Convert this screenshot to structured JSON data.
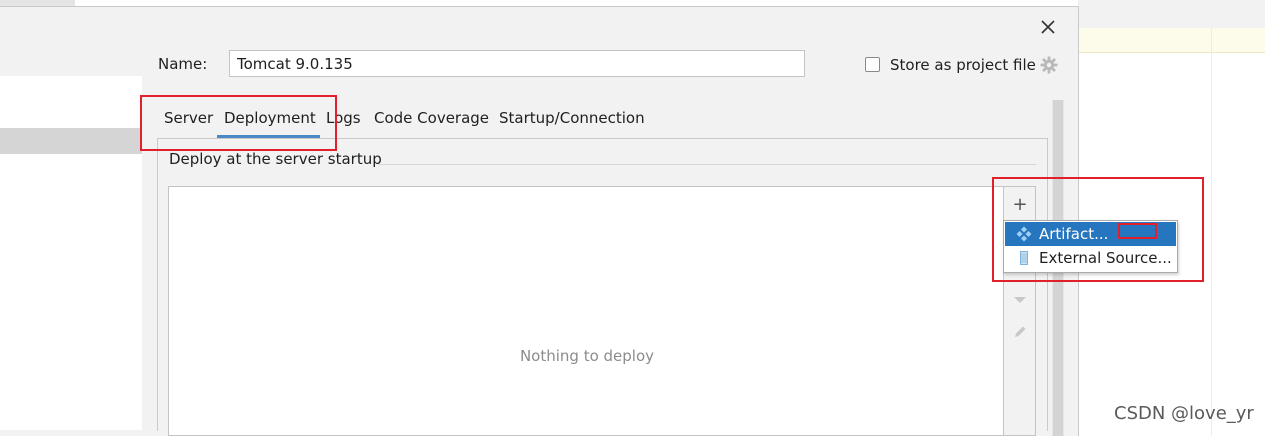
{
  "dialog": {
    "name_label": "Name:",
    "name_value": "Tomcat 9.0.135",
    "store_label": "Store as project file",
    "store_checked": false
  },
  "tabs": [
    {
      "label": "Server",
      "active": false
    },
    {
      "label": "Deployment",
      "active": true
    },
    {
      "label": "Logs",
      "active": false
    },
    {
      "label": "Code Coverage",
      "active": false
    },
    {
      "label": "Startup/Connection",
      "active": false
    }
  ],
  "deployment": {
    "section_title": "Deploy at the server startup",
    "empty_text": "Nothing to deploy"
  },
  "toolbar": {
    "add_symbol": "+"
  },
  "popup_menu": [
    {
      "label": "Artifact...",
      "icon": "artifact-icon",
      "selected": true
    },
    {
      "label": "External Source...",
      "icon": "external-source-icon",
      "selected": false
    }
  ],
  "watermark": "CSDN @love_yr",
  "colors": {
    "accent": "#4a88c7",
    "selection": "#2675bf",
    "annotation": "#e0202a"
  }
}
